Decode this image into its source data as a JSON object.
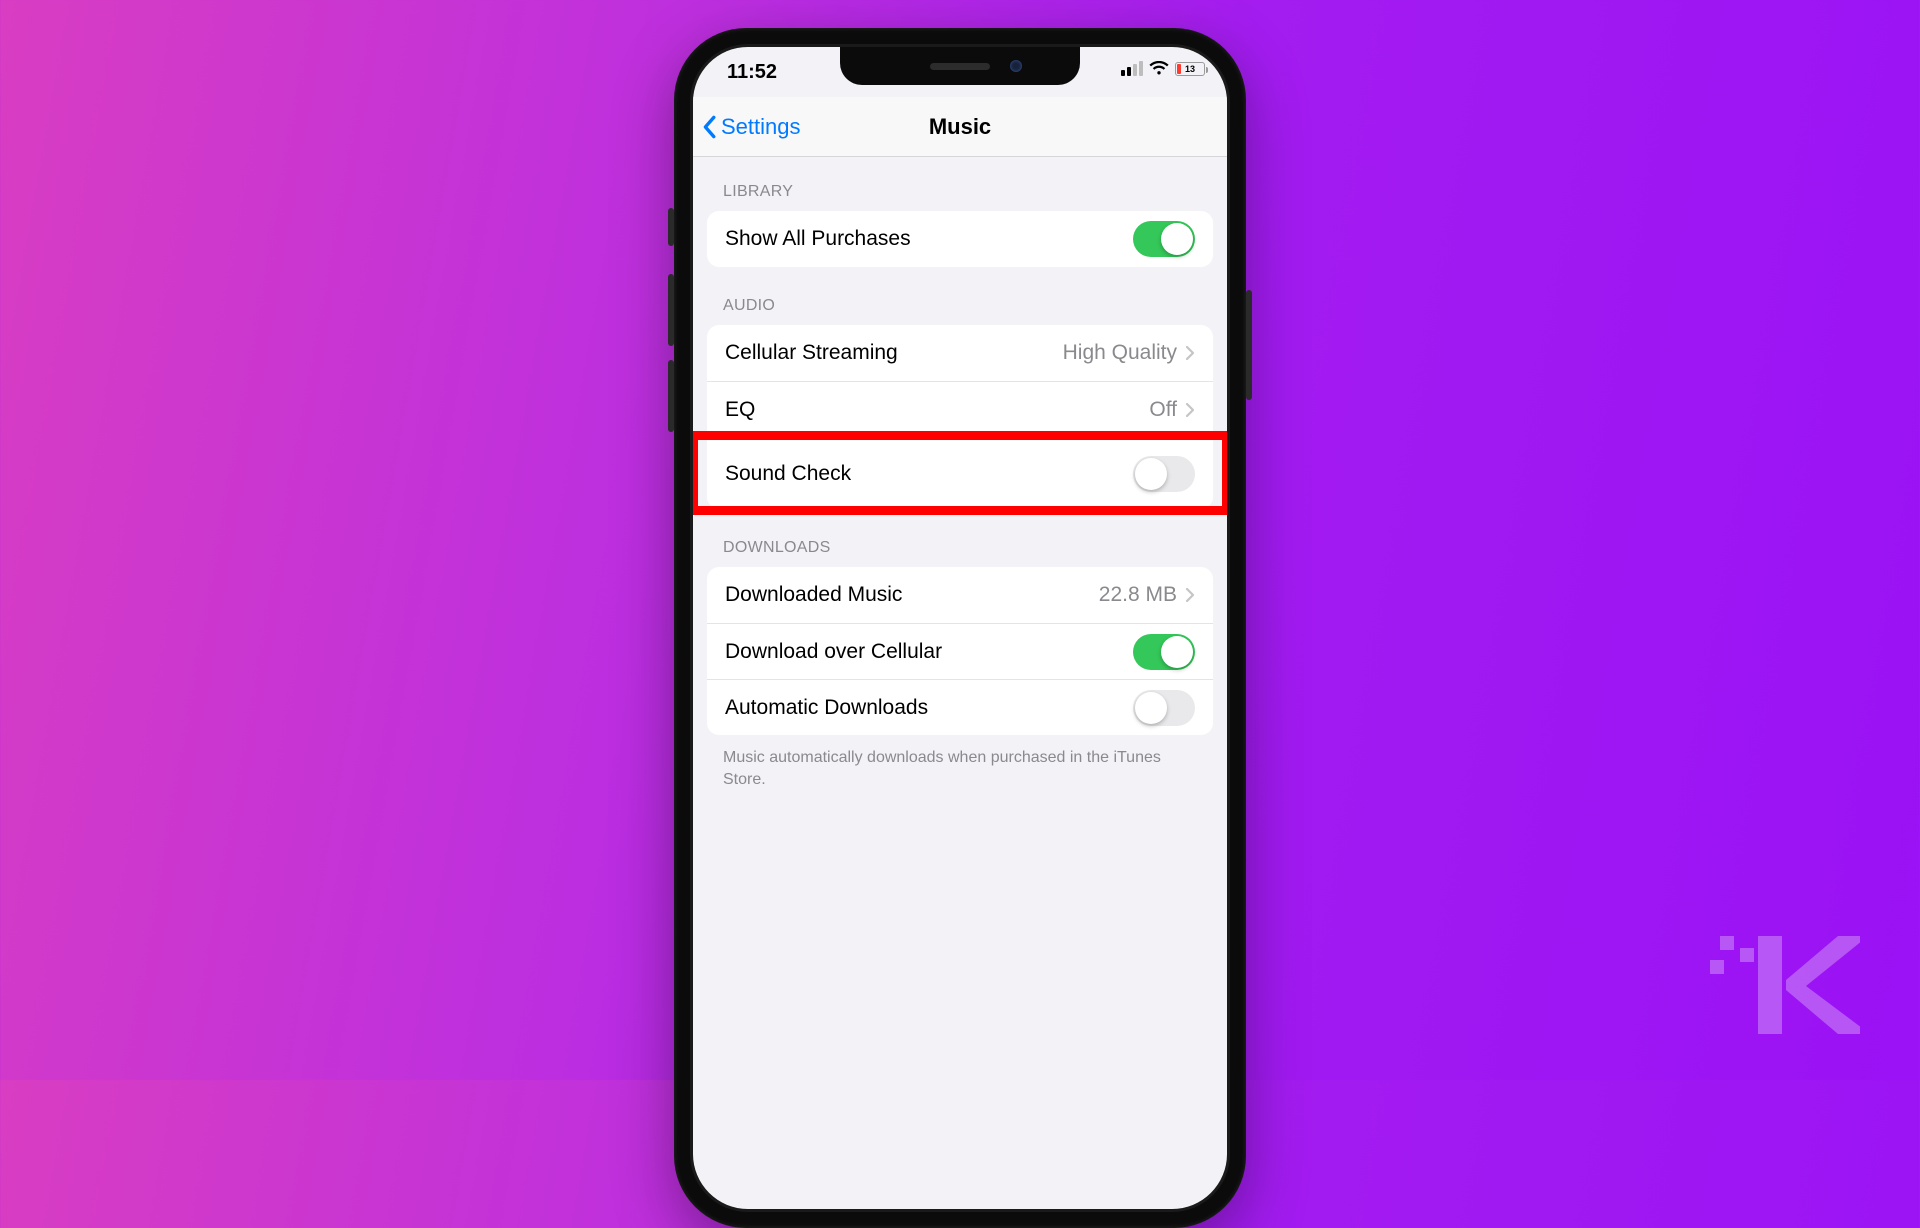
{
  "status": {
    "time": "11:52",
    "battery_percent": "13"
  },
  "nav": {
    "back_label": "Settings",
    "title": "Music"
  },
  "sections": {
    "library": {
      "header": "LIBRARY",
      "show_all_purchases": {
        "label": "Show All Purchases",
        "on": true
      }
    },
    "audio": {
      "header": "AUDIO",
      "cellular_streaming": {
        "label": "Cellular Streaming",
        "value": "High Quality"
      },
      "eq": {
        "label": "EQ",
        "value": "Off"
      },
      "sound_check": {
        "label": "Sound Check",
        "on": false,
        "highlighted": true
      }
    },
    "downloads": {
      "header": "DOWNLOADS",
      "downloaded_music": {
        "label": "Downloaded Music",
        "value": "22.8 MB"
      },
      "download_over_cellular": {
        "label": "Download over Cellular",
        "on": true
      },
      "automatic_downloads": {
        "label": "Automatic Downloads",
        "on": false
      },
      "footer": "Music automatically downloads when purchased in the iTunes Store."
    }
  },
  "colors": {
    "ios_blue": "#007aff",
    "ios_green": "#34c759",
    "highlight_red": "#ff0000",
    "bg_gradient_from": "#d83dc2",
    "bg_gradient_to": "#9a12f5"
  }
}
